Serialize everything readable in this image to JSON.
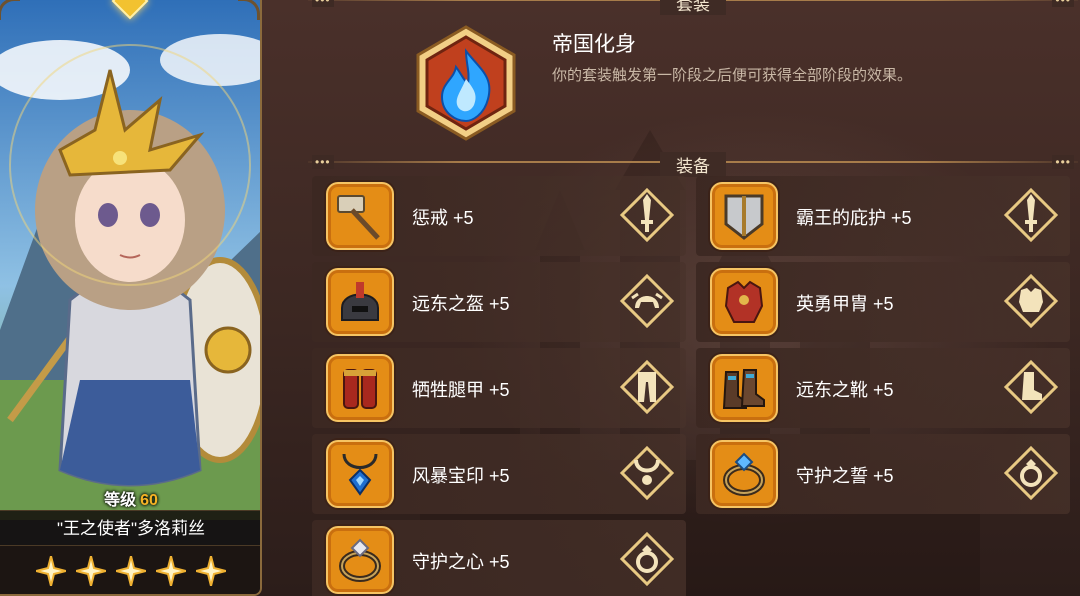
{
  "hero": {
    "level_label": "等级",
    "level_value": "60",
    "name": "\"王之使者\"多洛莉丝",
    "stars": 5
  },
  "set_section": {
    "title": "套装",
    "bonus_name": "帝国化身",
    "bonus_description": "你的套装触发第一阶段之后便可获得全部阶段的效果。",
    "bonus_icon": "blue-flame-icon"
  },
  "equip_section": {
    "title": "装备",
    "items": [
      {
        "label": "惩戒 +5",
        "icon": "war-hammer-icon",
        "slot_icon": "weapon-slot-icon"
      },
      {
        "label": "霸王的庇护 +5",
        "icon": "tower-shield-icon",
        "slot_icon": "offhand-slot-icon"
      },
      {
        "label": "远东之盔 +5",
        "icon": "helmet-icon",
        "slot_icon": "helmet-slot-icon"
      },
      {
        "label": "英勇甲胄 +5",
        "icon": "chest-armor-icon",
        "slot_icon": "armor-slot-icon"
      },
      {
        "label": "牺牲腿甲 +5",
        "icon": "leg-armor-icon",
        "slot_icon": "legs-slot-icon"
      },
      {
        "label": "远东之靴 +5",
        "icon": "boots-icon",
        "slot_icon": "boots-slot-icon"
      },
      {
        "label": "风暴宝印 +5",
        "icon": "amulet-icon",
        "slot_icon": "necklace-slot-icon"
      },
      {
        "label": "守护之誓 +5",
        "icon": "ring-icon",
        "slot_icon": "ring-slot-icon"
      },
      {
        "label": "守护之心 +5",
        "icon": "ring-icon",
        "slot_icon": "ring-slot-icon"
      }
    ]
  },
  "colors": {
    "accent_gold": "#f6b324",
    "icon_orange": "#e48d16",
    "panel_brown": "#3b2722"
  }
}
